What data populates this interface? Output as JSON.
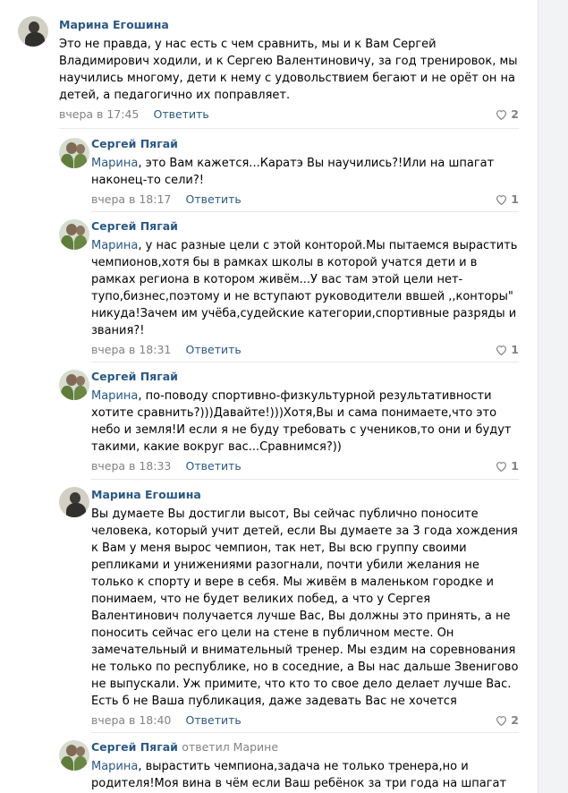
{
  "comments": [
    {
      "author": "Марина Егошина",
      "reply_to": "",
      "mention": "",
      "text": "Это не правда, у нас есть с чем сравнить, мы и к Вам Сергей Владимирович ходили, и к Сергею Валентиновичу, за год тренировок, мы научились многому, дети к нему с удовольствием бегают и не орёт он на детей, а педагогично их поправляет.",
      "time": "вчера в 17:45",
      "reply_label": "Ответить",
      "likes": "2"
    },
    {
      "author": "Сергей Пягай",
      "reply_to": "",
      "mention": "Марина",
      "text": ", это Вам кажется...Каратэ Вы научились?!Или на шпагат наконец-то сели?!",
      "time": "вчера в 18:17",
      "reply_label": "Ответить",
      "likes": "1"
    },
    {
      "author": "Сергей Пягай",
      "reply_to": "",
      "mention": "Марина",
      "text": ", у нас разные цели с этой конторой.Мы пытаемся вырастить чемпионов,хотя бы в рамках школы в которой учатся дети и в рамках региона в котором живём...У вас там этой цели нет-тупо,бизнес,поэтому и не вступают руководители ввшей ,,конторы\" никуда!Зачем им учёба,судейские категории,спортивные разряды и звания?!",
      "time": "вчера в 18:31",
      "reply_label": "Ответить",
      "likes": "1"
    },
    {
      "author": "Сергей Пягай",
      "reply_to": "",
      "mention": "Марина",
      "text": ", по-поводу спортивно-физкультурной результативности хотите сравнить?)))Давайте!)))Хотя,Вы и сама понимаете,что это небо и земля!И если я не буду требовать с учеников,то они и будут такими, какие вокруг вас...Сравнимся?))",
      "time": "вчера в 18:33",
      "reply_label": "Ответить",
      "likes": "1"
    },
    {
      "author": "Марина Егошина",
      "reply_to": "",
      "mention": "",
      "text": "Вы думаете Вы достигли высот, Вы сейчас публично поносите человека, который учит детей, если Вы думаете за 3 года хождения к Вам у меня вырос чемпион, так нет, Вы всю группу своими репликами и унижениями разогнали, почти убили желания не только к спорту и вере в себя. Мы живём в маленьком городке и понимаем, что не будет великих побед, а что у Сергея Валентинович получается лучше Вас, Вы должны это принять, а не поносить сейчас его цели на стене в публичном месте. Он замечательный и внимательный тренер. Мы ездим на соревнования не только по республике, но в соседние, а Вы нас дальше Звенигово не выпускали. Уж примите, что кто то свое дело делает лучше Вас. Есть б не Ваша публикация, даже задевать Вас не хочется",
      "time": "вчера в 18:40",
      "reply_label": "Ответить",
      "likes": "2"
    },
    {
      "author": "Сергей Пягай",
      "reply_to": "ответил Марине",
      "mention": "Марина",
      "text": ", вырастить чемпиона,задача не только тренера,но и родителя!Моя вина в чём если Ваш ребёнок за три года на шпагат",
      "time": "",
      "reply_label": "",
      "likes": ""
    }
  ]
}
